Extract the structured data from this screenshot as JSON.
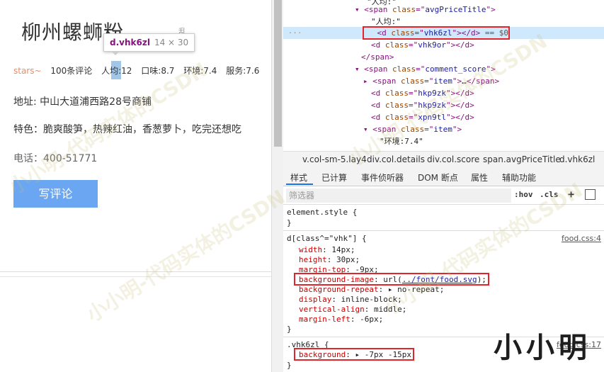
{
  "page": {
    "title": "柳州螺蛳粉",
    "title_tail": "乱",
    "stars": "stars~",
    "review_count": "100条评论",
    "avg_price": "人均:12",
    "taste": "口味:8.7",
    "environment": "环境:7.4",
    "service": "服务:7.6",
    "address": "地址: 中山大道浦西路28号商铺",
    "features": "特色：脆爽酸笋，热辣红油，香葱萝卜，吃完还想吃",
    "phone": "电话：400-51771",
    "write_review": "写评论"
  },
  "tooltip": {
    "name": "d.vhk6zl",
    "size": "14 × 30"
  },
  "elements": [
    {
      "indent": 0,
      "text": "\"人均:\""
    },
    {
      "prefix": "▾",
      "tag": "span",
      "attr": "class",
      "value": "avgPriceTitle"
    },
    {
      "tag": "d",
      "attr": "class",
      "value": "vhk6zl",
      "selected_suffix": "== $0"
    },
    {
      "tag": "d",
      "attr": "class",
      "value": "vhk9or"
    },
    {
      "closing": "span"
    },
    {
      "prefix": "▾",
      "tag": "span",
      "attr": "class",
      "value": "comment_score"
    },
    {
      "prefix": "▸",
      "tag": "span",
      "attr": "class",
      "value": "item",
      "tail": "…</span>"
    },
    {
      "tag": "d",
      "attr": "class",
      "value": "hkp9zk"
    },
    {
      "tag": "d",
      "attr": "class",
      "value": "hkp9zk"
    },
    {
      "tag": "d",
      "attr": "class",
      "value": "xpn9tl"
    },
    {
      "prefix": "▾",
      "tag": "span",
      "attr": "class",
      "value": "item"
    },
    {
      "text": "\"环境:7.4\""
    }
  ],
  "breadcrumbs": [
    "v.col-sm-5.lay4",
    "div.col.details",
    "div.col.score",
    "span.avgPriceTitle",
    "d.vhk6zl"
  ],
  "tabs": [
    "样式",
    "已计算",
    "事件侦听器",
    "DOM 断点",
    "属性",
    "辅助功能"
  ],
  "filter": {
    "placeholder": "筛选器",
    "hov": ":hov",
    "cls": ".cls",
    "plus": "+"
  },
  "styles": {
    "element_style": "element.style {",
    "rule1_selector": "d[class^=\"vhk\"] {",
    "rule1_source": "food.css:4",
    "rule1_props": [
      {
        "name": "width",
        "value": "14px;"
      },
      {
        "name": "height",
        "value": "30px;"
      },
      {
        "name": "margin-top",
        "value": "-9px;"
      },
      {
        "name": "background-image",
        "value_pre": "url(",
        "value_link": "../font/food.svg",
        "value_post": ");"
      },
      {
        "name": "background-repeat",
        "value": "▸ no-repeat;"
      },
      {
        "name": "display",
        "value": "inline-block;"
      },
      {
        "name": "vertical-align",
        "value": "middle;"
      },
      {
        "name": "margin-left",
        "value": "-6px;"
      }
    ],
    "rule2_selector": ".vhk6zl {",
    "rule2_source": "food.css:17",
    "rule2_props": [
      {
        "name": "background",
        "value": "▸ -7px -15px;"
      }
    ],
    "close": "}"
  },
  "watermark": "小小明-代码实体的CSDN",
  "signature": "小小明",
  "colors": {
    "accent": "#1a73e8",
    "highlight_box": "#e0262b",
    "button": "#6aa6f2"
  }
}
